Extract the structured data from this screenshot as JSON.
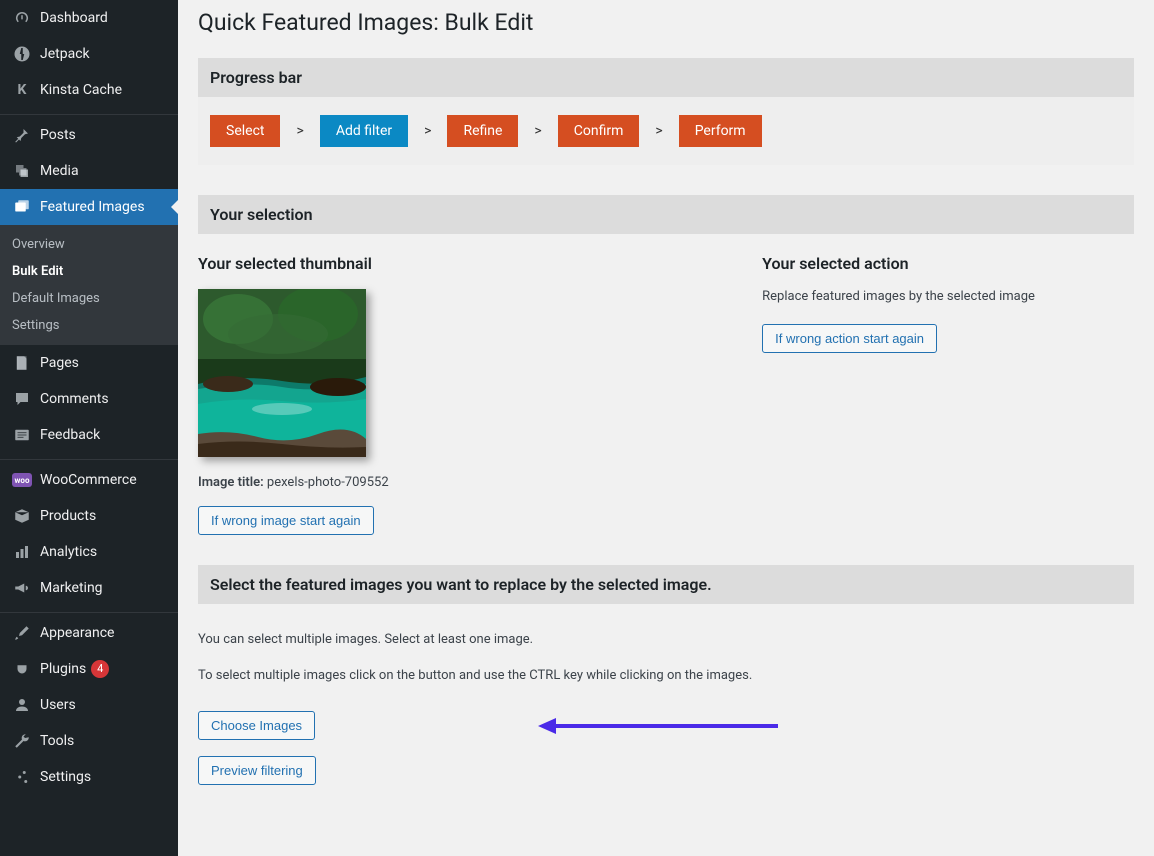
{
  "sidebar": {
    "items": [
      {
        "label": "Dashboard"
      },
      {
        "label": "Jetpack"
      },
      {
        "label": "Kinsta Cache"
      },
      {
        "label": "Posts"
      },
      {
        "label": "Media"
      },
      {
        "label": "Featured Images"
      },
      {
        "label": "Pages"
      },
      {
        "label": "Comments"
      },
      {
        "label": "Feedback"
      },
      {
        "label": "WooCommerce"
      },
      {
        "label": "Products"
      },
      {
        "label": "Analytics"
      },
      {
        "label": "Marketing"
      },
      {
        "label": "Appearance"
      },
      {
        "label": "Plugins"
      },
      {
        "label": "Users"
      },
      {
        "label": "Tools"
      },
      {
        "label": "Settings"
      }
    ],
    "plugin_badge": "4",
    "submenu": {
      "overview": "Overview",
      "bulkedit": "Bulk Edit",
      "defaultimages": "Default Images",
      "settings": "Settings"
    }
  },
  "page": {
    "title": "Quick Featured Images: Bulk Edit",
    "progress_label": "Progress bar",
    "steps": {
      "select": "Select",
      "addfilter": "Add filter",
      "refine": "Refine",
      "confirm": "Confirm",
      "perform": "Perform"
    },
    "step_sep": ">",
    "selection_label": "Your selection",
    "thumb_heading": "Your selected thumbnail",
    "image_title_label": "Image title:",
    "image_title_value": "pexels-photo-709552",
    "wrong_image_btn": "If wrong image start again",
    "action_heading": "Your selected action",
    "action_desc": "Replace featured images by the selected image",
    "wrong_action_btn": "If wrong action start again",
    "select_images_heading": "Select the featured images you want to replace by the selected image.",
    "instr1": "You can select multiple images. Select at least one image.",
    "instr2": "To select multiple images click on the button and use the CTRL key while clicking on the images.",
    "choose_btn": "Choose Images",
    "preview_btn": "Preview filtering"
  }
}
